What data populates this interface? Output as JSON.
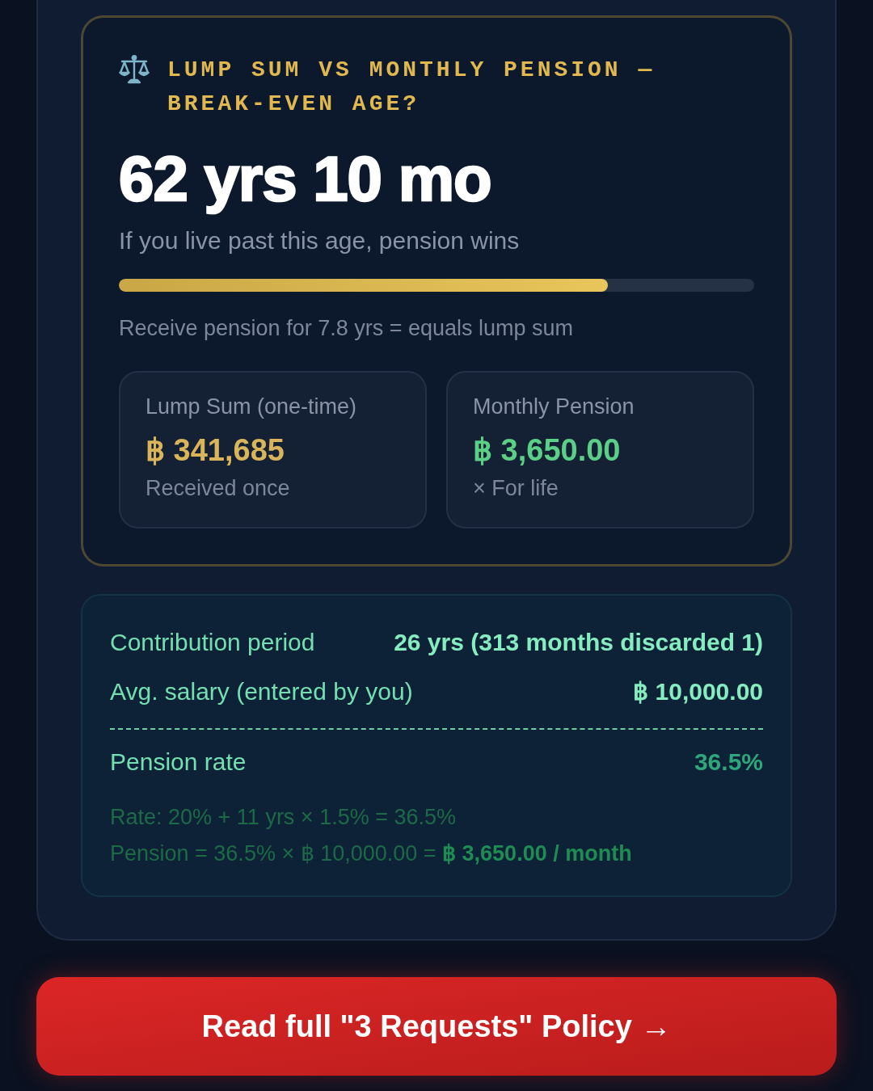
{
  "breakeven": {
    "title": "LUMP SUM VS MONTHLY PENSION — BREAK-EVEN AGE?",
    "age": "62 yrs 10 mo",
    "subtitle": "If you live past this age, pension wins",
    "progress": {
      "level": 0.77
    },
    "note": "Receive pension for 7.8 yrs = equals lump sum",
    "options": [
      {
        "label": "Lump Sum (one-time)",
        "amount": "฿ 341,685",
        "caption": "Received once",
        "color": "#d9b45a"
      },
      {
        "label": "Monthly Pension",
        "amount": "฿ 3,650.00",
        "caption": "× For life",
        "color": "#5ccf86"
      }
    ]
  },
  "calculation": {
    "inputs": [
      {
        "label": "Contribution period",
        "value": "26 yrs (313 months discarded 1)"
      },
      {
        "label": "Avg. salary (entered by you)",
        "value": "฿ 10,000.00"
      }
    ],
    "result": {
      "label": "Pension rate",
      "value": "36.5%"
    },
    "formulas": [
      "Rate: 20% + 11 yrs × 1.5% = 36.5%",
      "Pension = 36.5% × ฿ 10,000.00 = **฿ 3,650.00 / month**"
    ]
  },
  "button": {
    "label": "Read full \"3 Requests\" Policy →"
  }
}
